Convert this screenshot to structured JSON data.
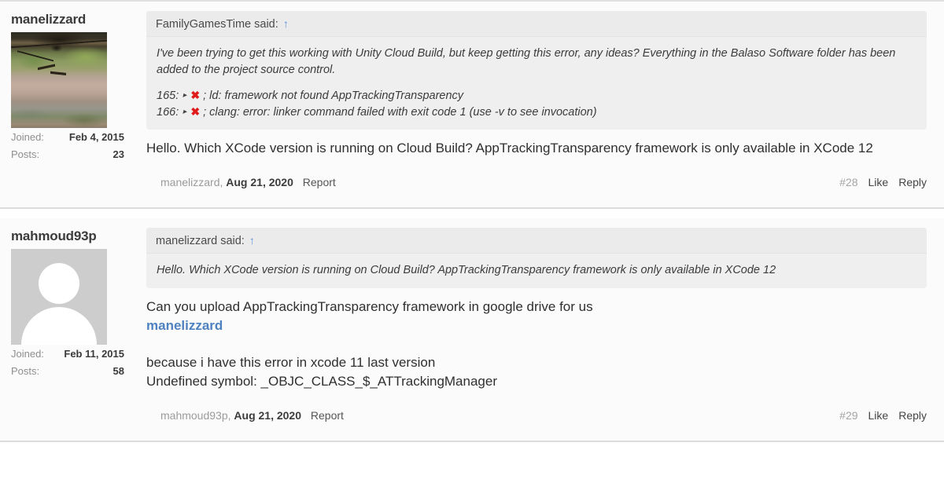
{
  "thread": {
    "posts": [
      {
        "author": "manelizzard",
        "avatar_type": "photo",
        "stats": [
          {
            "label": "Joined:",
            "value": "Feb 4, 2015"
          },
          {
            "label": "Posts:",
            "value": "23"
          }
        ],
        "quote": {
          "header_author": "FamilyGamesTime said:",
          "header_arrow": "↑",
          "paragraph": "I've been trying to get this working with Unity Cloud Build, but keep getting this error, any ideas? Everything in the Balaso Software folder has been added to the project source control.",
          "error_lines": [
            {
              "num": "165:",
              "triangle": "▸",
              "mark": "✖",
              "text": "; ld: framework not found AppTrackingTransparency"
            },
            {
              "num": "166:",
              "triangle": "▸",
              "mark": "✖",
              "text": "; clang: error: linker command failed with exit code 1 (use -v to see invocation)"
            }
          ]
        },
        "body_lines": [
          "Hello. Which XCode version is running on Cloud Build? AppTrackingTransparency framework is only available in XCode 12"
        ],
        "footer": {
          "author": "manelizzard,",
          "date": "Aug 21, 2020",
          "report": "Report",
          "post_number": "#28",
          "like": "Like",
          "reply": "Reply"
        }
      },
      {
        "author": "mahmoud93p",
        "avatar_type": "placeholder",
        "stats": [
          {
            "label": "Joined:",
            "value": "Feb 11, 2015"
          },
          {
            "label": "Posts:",
            "value": "58"
          }
        ],
        "quote": {
          "header_author": "manelizzard said:",
          "header_arrow": "↑",
          "paragraph": "Hello. Which XCode version is running on Cloud Build? AppTrackingTransparency framework is only available in XCode 12",
          "error_lines": []
        },
        "body_lines": [
          "Can you upload AppTrackingTransparency framework in google drive for us",
          "because i have this error in xcode 11 last version",
          "Undefined symbol: _OBJC_CLASS_$_ATTrackingManager"
        ],
        "mention": "manelizzard",
        "footer": {
          "author": "mahmoud93p,",
          "date": "Aug 21, 2020",
          "report": "Report",
          "post_number": "#29",
          "like": "Like",
          "reply": "Reply"
        }
      }
    ]
  },
  "colors": {
    "link": "#4e81bf",
    "quote_arrow": "#5b92d6",
    "error_mark": "#e01b1b",
    "post_bg": "#fbfbfb",
    "quote_bg": "#efefef"
  }
}
